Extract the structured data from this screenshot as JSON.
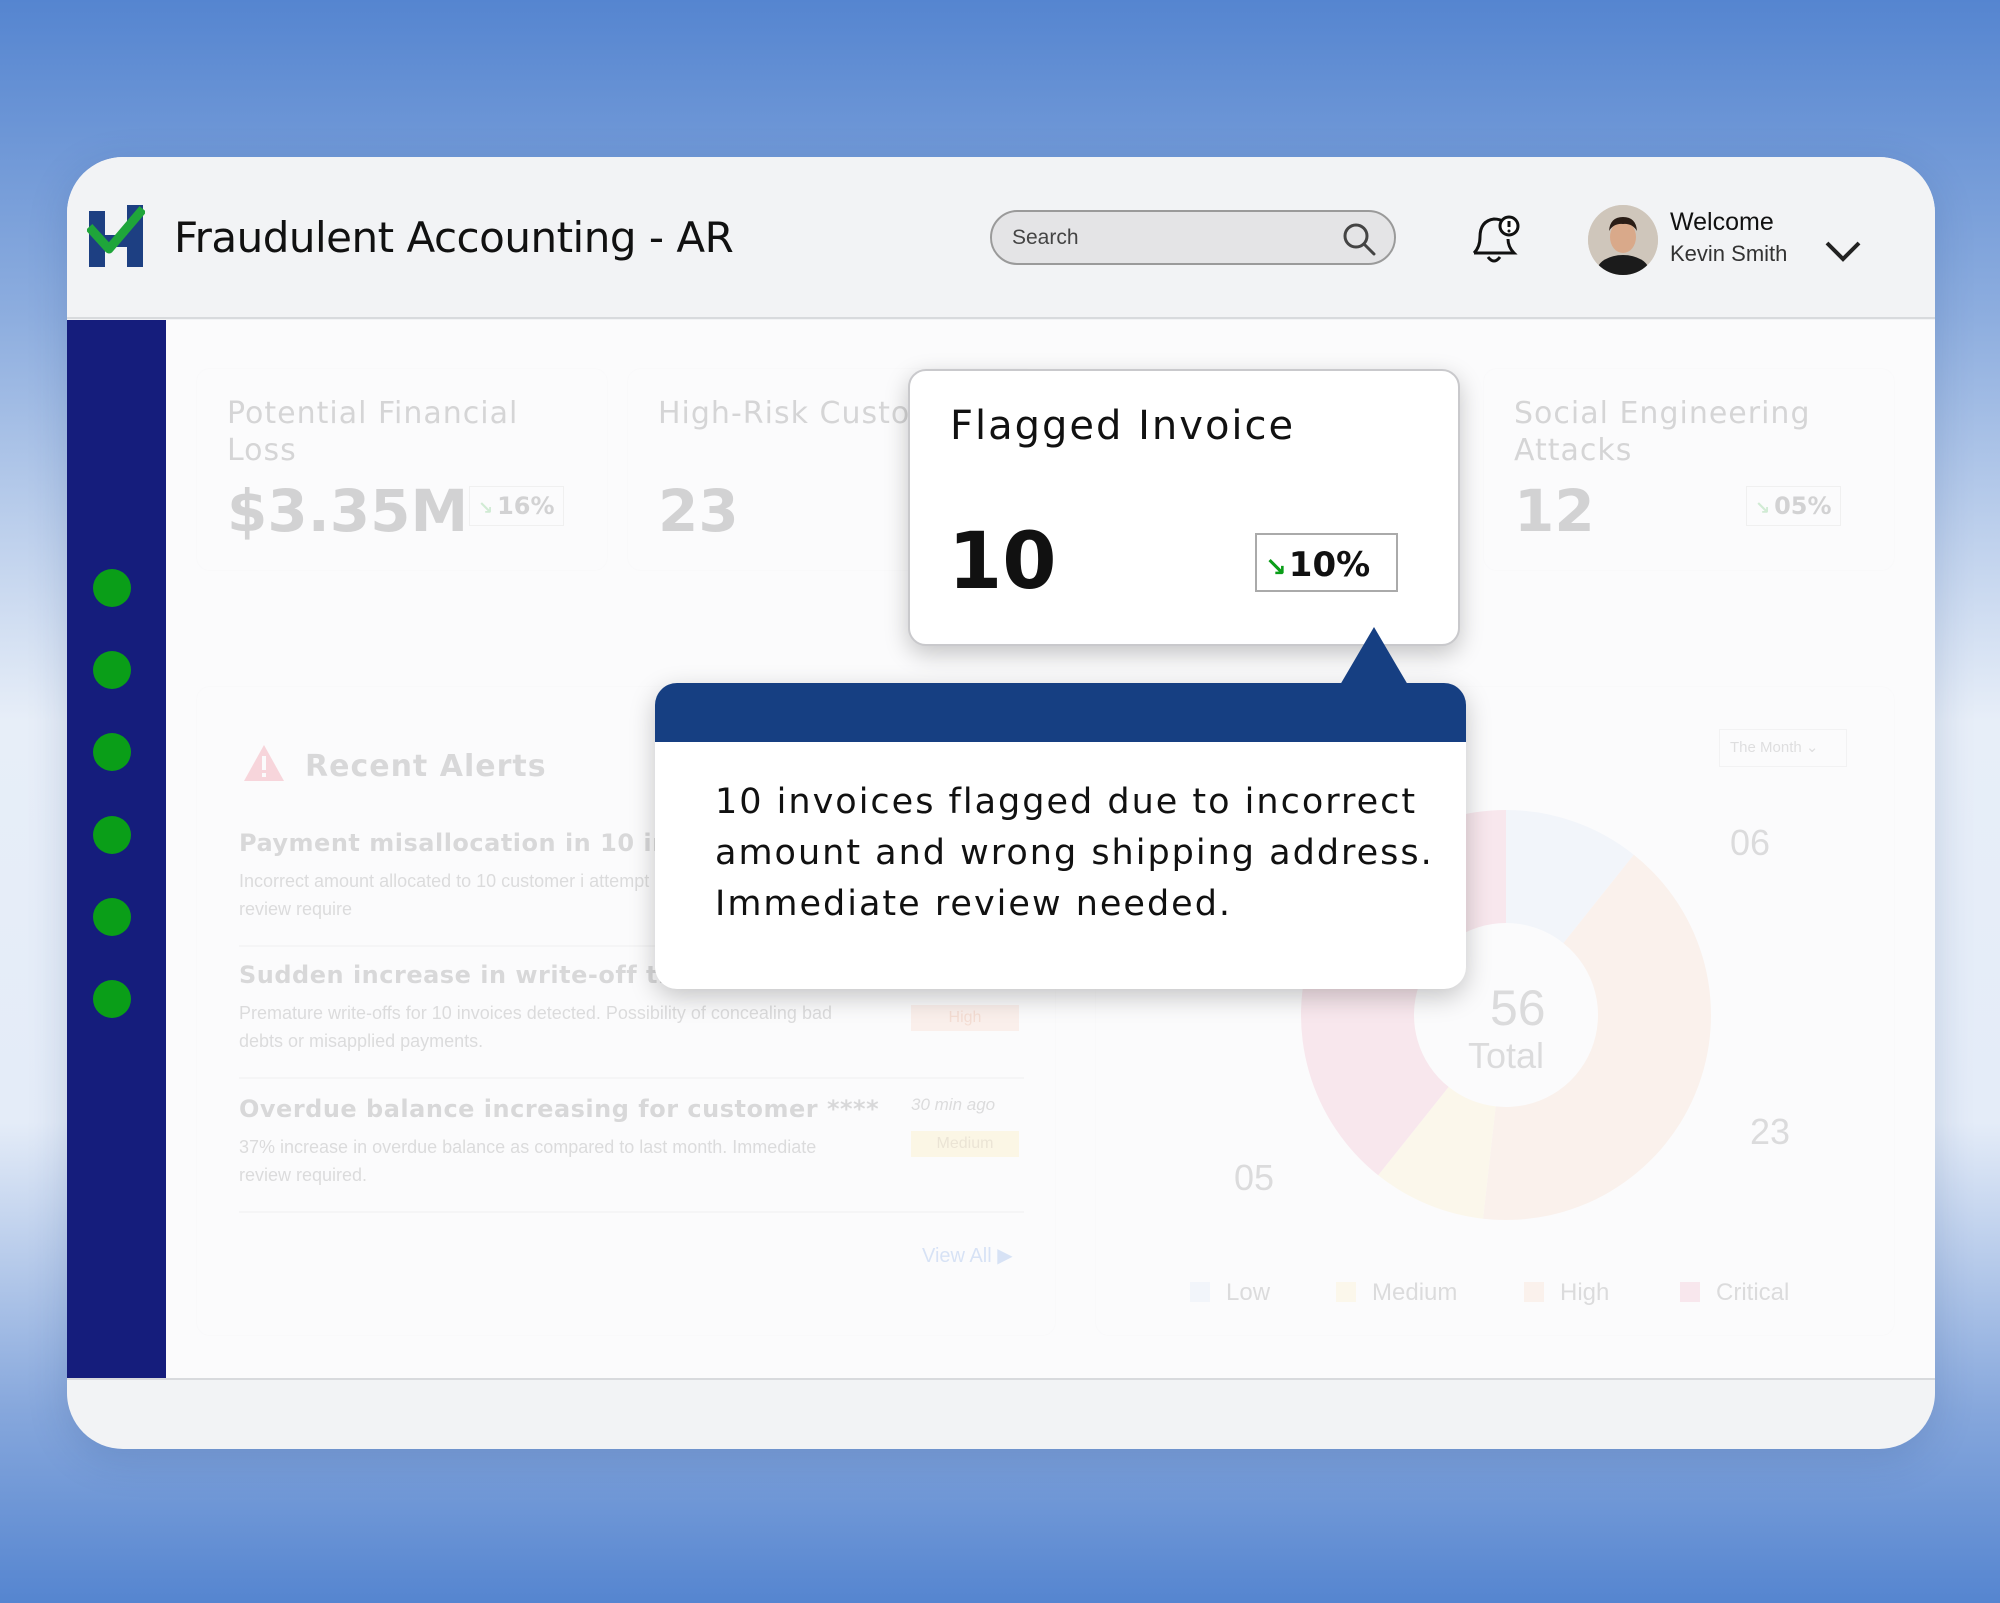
{
  "app": {
    "title": "Fraudulent Accounting - AR"
  },
  "search": {
    "placeholder": "Search"
  },
  "user": {
    "welcome": "Welcome",
    "name": "Kevin Smith"
  },
  "sidebar": {
    "item_count": 6,
    "dot_color": "#0a9e18"
  },
  "kpis": [
    {
      "label": "Potential Financial Loss",
      "value": "$3.35M",
      "change": "16%"
    },
    {
      "label": "High-Risk Custo",
      "value": "23"
    },
    {
      "label": "Social Engineering Attacks",
      "value": "12",
      "change": "05%"
    }
  ],
  "popup": {
    "title": "Flagged Invoice",
    "value": "10",
    "change": "10%"
  },
  "tooltip": {
    "text": "10 invoices flagged due to incorrect amount and wrong shipping address. Immediate review needed."
  },
  "alerts": {
    "title": "Recent Alerts",
    "items": [
      {
        "title": "Payment misallocation in 10 invo",
        "desc": "Incorrect amount allocated to 10 customer i attempt possible. Immediate review require"
      },
      {
        "title": "Sudden increase in write-off trar",
        "desc": "Premature write-offs for 10 invoices detected. Possibility of concealing bad debts or misapplied payments.",
        "badge": "High"
      },
      {
        "title": "Overdue balance increasing for customer ****",
        "desc": "37% increase in overdue balance as compared to last month. Immediate review required.",
        "time": "30 min ago",
        "badge": "Medium"
      }
    ],
    "view_all": "View All"
  },
  "chart_data": {
    "type": "pie",
    "total_value": "56",
    "total_label": "Total",
    "filter": "The Month",
    "slices": [
      {
        "name": "Low",
        "value": 6,
        "color": "#c9d9f5"
      },
      {
        "name": "High",
        "value": 23,
        "color": "#f9c4a3"
      },
      {
        "name": "Medium",
        "value": 5,
        "color": "#fbe59a"
      },
      {
        "name": "Critical",
        "value": 22,
        "color": "#ee8aa6"
      }
    ],
    "labels": [
      "06",
      "23",
      "05"
    ],
    "legend": [
      "Low",
      "Medium",
      "High",
      "Critical"
    ]
  },
  "colors": {
    "brand_navy": "#151d7c",
    "tooltip_header": "#163f82",
    "trend_green": "#0a9e18"
  }
}
